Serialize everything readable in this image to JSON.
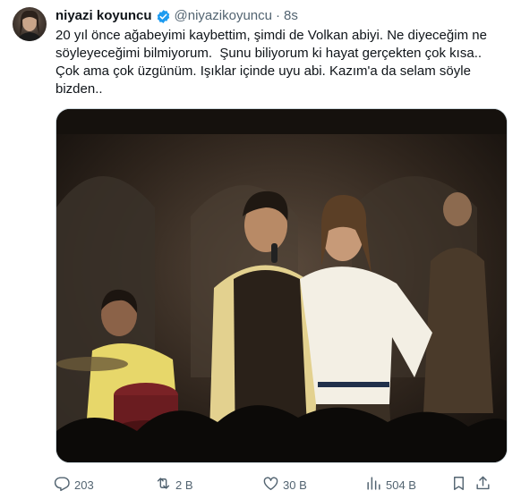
{
  "tweet": {
    "author_name": "niyazi koyuncu",
    "handle": "@niyazikoyuncu",
    "separator": "·",
    "time": "8s",
    "text": "20 yıl önce ağabeyimi kaybettim, şimdi de Volkan abiyi. Ne diyeceğim ne söyleyeceğimi bilmiyorum.  Şunu biliyorum ki hayat gerçekten çok kısa.. Çok ama çok üzgünüm. Işıklar içinde uyu abi. Kazım'a da selam söyle bizden..",
    "verified_color": "#1d9bf0"
  },
  "actions": {
    "replies": "203",
    "reposts": "2 B",
    "likes": "30 B",
    "views": "504 B"
  },
  "icons": {
    "verified": "verified-badge-icon",
    "reply": "reply-icon",
    "repost": "repost-icon",
    "like": "heart-icon",
    "views": "views-chart-icon",
    "bookmark": "bookmark-icon",
    "share": "share-icon"
  }
}
